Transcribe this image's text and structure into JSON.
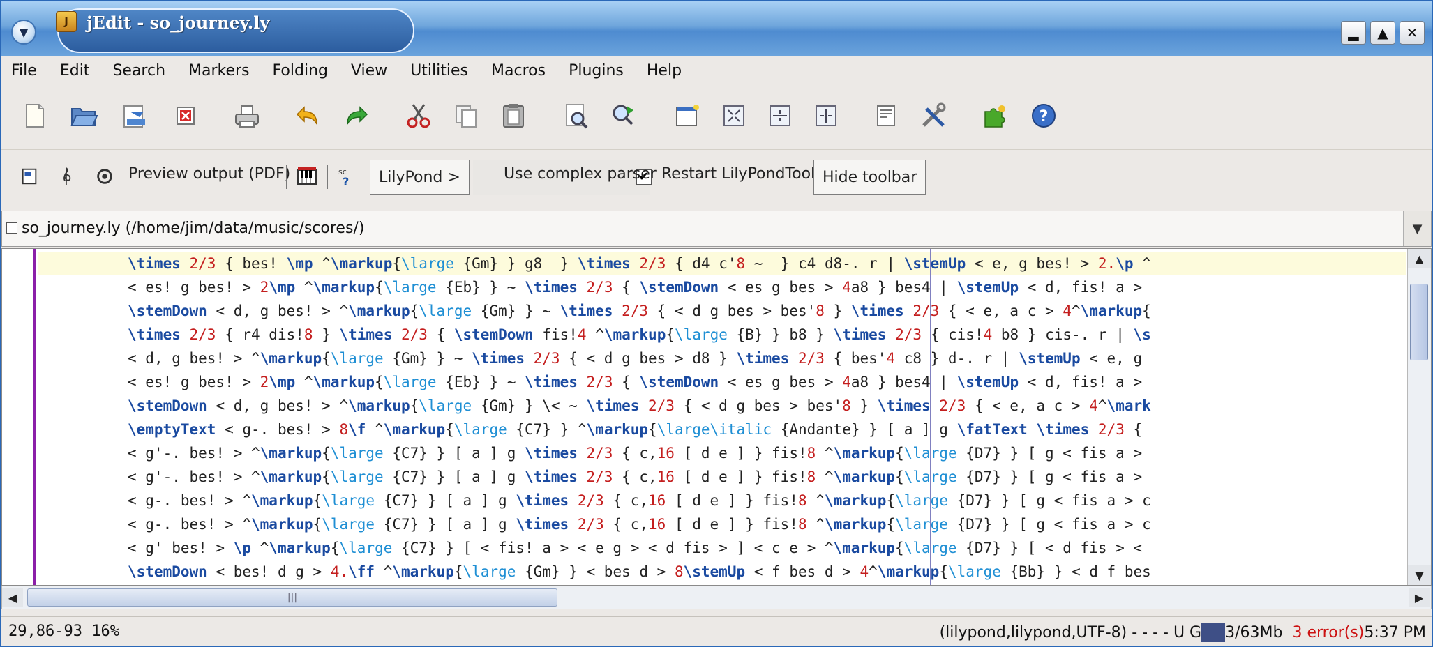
{
  "window": {
    "title": "jEdit - so_journey.ly",
    "controls": [
      "minimize",
      "maximize",
      "close"
    ]
  },
  "menu": [
    "File",
    "Edit",
    "Search",
    "Markers",
    "Folding",
    "View",
    "Utilities",
    "Macros",
    "Plugins",
    "Help"
  ],
  "toolbar": {
    "buttons": [
      "new-file",
      "open-file",
      "reload",
      "close-buffer",
      "print",
      "undo",
      "redo",
      "cut",
      "copy",
      "paste",
      "find",
      "find-next",
      "new-view",
      "split",
      "split-vertical",
      "unsplit",
      "buffer-options",
      "global-options",
      "plugin-manager",
      "help"
    ]
  },
  "lilypond_toolbar": {
    "preview_label": "Preview output (PDF)",
    "menu_button": "LilyPond >",
    "complex_parser_label": "Use complex parser",
    "complex_parser_checked": true,
    "restart_label": "Restart LilyPondTool",
    "hide_label": "Hide toolbar"
  },
  "buffer": {
    "label": "so_journey.ly (/home/jim/data/music/scores/)"
  },
  "editor": {
    "lines": [
      "\\times 2/3 { bes! \\mp ^\\markup{\\large {Gm} } g8  } \\times 2/3 { d4 c'8 ~  } c4 d8-. r | \\stemUp < e, g bes! > 2.\\p ^",
      "< es! g bes! > 2\\mp ^\\markup{\\large {Eb} } ~ \\times 2/3 { \\stemDown < es g bes > 4a8 } bes4 | \\stemUp < d, fis! a >",
      "\\stemDown < d, g bes! > ^\\markup{\\large {Gm} } ~ \\times 2/3 { < d g bes > bes'8 } \\times 2/3 { < e, a c > 4^\\markup{",
      "\\times 2/3 { r4 dis!8 } \\times 2/3 { \\stemDown fis!4 ^\\markup{\\large {B} } b8 } \\times 2/3 { cis!4 b8 } cis-. r | \\s",
      "< d, g bes! > ^\\markup{\\large {Gm} } ~ \\times 2/3 { < d g bes > d8 } \\times 2/3 { bes'4 c8 } d-. r | \\stemUp < e, g",
      "< es! g bes! > 2\\mp ^\\markup{\\large {Eb} } ~ \\times 2/3 { \\stemDown < es g bes > 4a8 } bes4 | \\stemUp < d, fis! a >",
      "\\stemDown < d, g bes! > ^\\markup{\\large {Gm} } \\< ~ \\times 2/3 { < d g bes > bes'8 } \\times 2/3 { < e, a c > 4^\\mark",
      "\\emptyText < g-. bes! > 8\\f ^\\markup{\\large {C7} } ^\\markup{\\large\\italic {Andante} } [ a ] g \\fatText \\times 2/3 {",
      "< g'-. bes! > ^\\markup{\\large {C7} } [ a ] g \\times 2/3 { c,16 [ d e ] } fis!8 ^\\markup{\\large {D7} } [ g < fis a >",
      "< g'-. bes! > ^\\markup{\\large {C7} } [ a ] g \\times 2/3 { c,16 [ d e ] } fis!8 ^\\markup{\\large {D7} } [ g < fis a >",
      "< g-. bes! > ^\\markup{\\large {C7} } [ a ] g \\times 2/3 { c,16 [ d e ] } fis!8 ^\\markup{\\large {D7} } [ g < fis a > c",
      "< g-. bes! > ^\\markup{\\large {C7} } [ a ] g \\times 2/3 { c,16 [ d e ] } fis!8 ^\\markup{\\large {D7} } [ g < fis a > c",
      "< g' bes! > \\p ^\\markup{\\large {C7} } [ < fis! a > < e g > < d fis > ] < c e > ^\\markup{\\large {D7} } [ < d fis > <",
      "\\stemDown < bes! d g > 4.\\ff ^\\markup{\\large {Gm} } < bes d > 8\\stemUp < f bes d > 4^\\markup{\\large {Bb} } < d f bes"
    ]
  },
  "status": {
    "caret": "29,86-93 16%",
    "mode": "(lilypond,lilypond,UTF-8) - - - - U G",
    "memory": "3/63Mb",
    "errors": "3 error(s)",
    "time": "5:37 PM"
  },
  "colors": {
    "keyword": "#1a4aa0",
    "number": "#c41e1e",
    "markup": "#1f8fd4",
    "error": "#cc1111",
    "gutter_marker": "#8b1fa8"
  }
}
